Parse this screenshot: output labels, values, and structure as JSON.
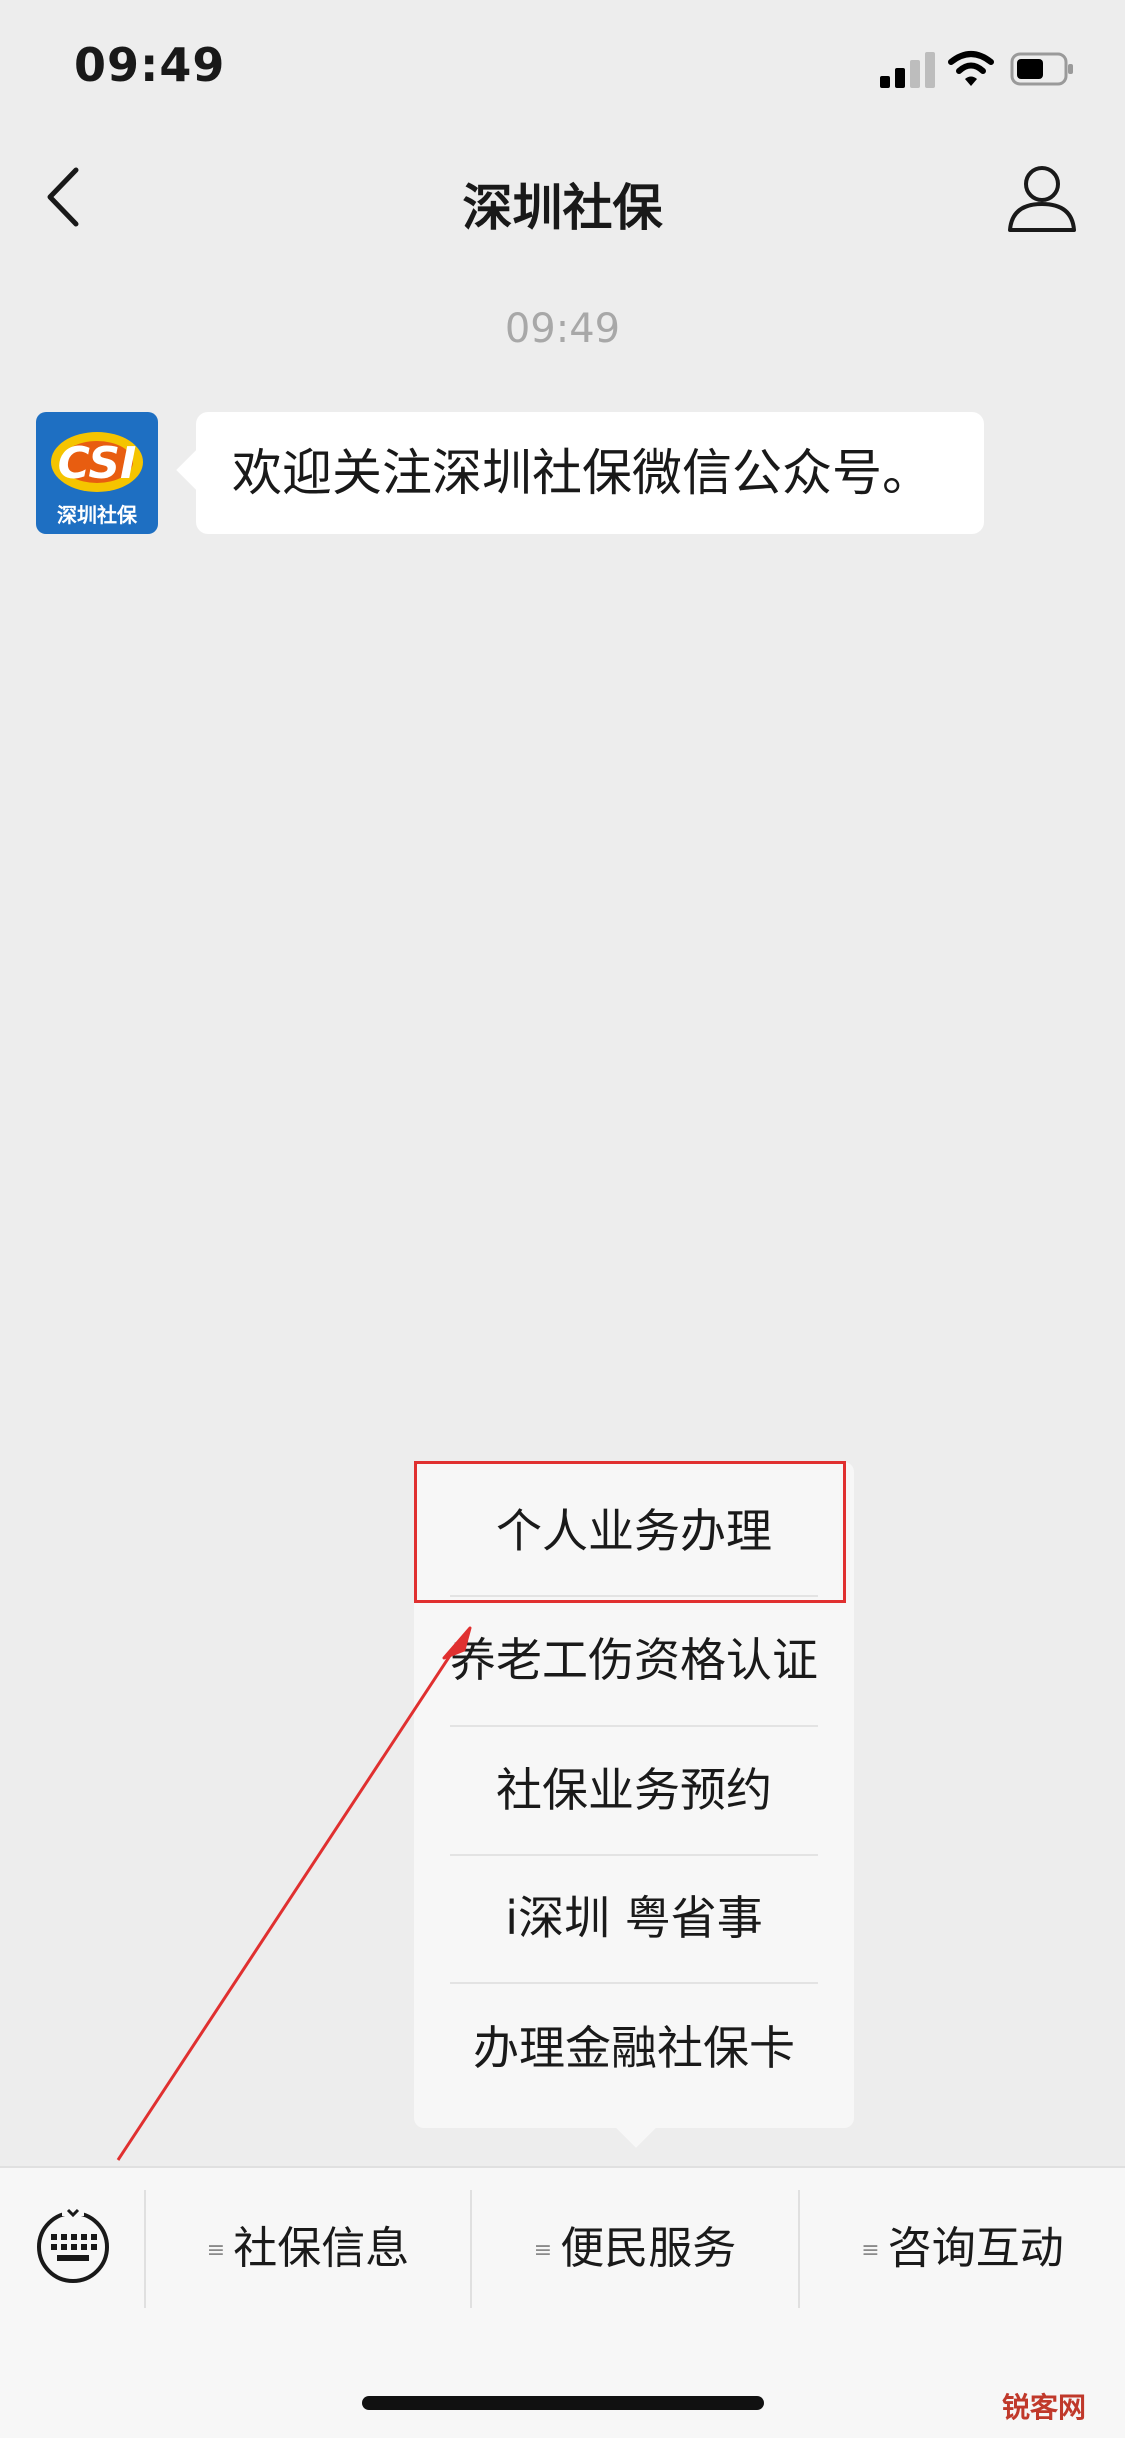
{
  "status_bar": {
    "time": "09:49"
  },
  "nav": {
    "title": "深圳社保"
  },
  "chat": {
    "timestamp": "09:49",
    "avatar_logo_text": "CSI",
    "avatar_caption": "深圳社保",
    "message": "欢迎关注深圳社保微信公众号。"
  },
  "popup_menu": {
    "items": [
      {
        "label": "个人业务办理"
      },
      {
        "label": "养老工伤资格认证"
      },
      {
        "label": "社保业务预约"
      },
      {
        "label": "i深圳 粤省事"
      },
      {
        "label": "办理金融社保卡"
      }
    ],
    "highlighted_index": 0
  },
  "bottom_bar": {
    "tab_icon_glyph": "≡",
    "tabs": [
      {
        "label": "社保信息"
      },
      {
        "label": "便民服务"
      },
      {
        "label": "咨询互动"
      }
    ]
  },
  "watermark": "锐客网",
  "colors": {
    "annotation": "#e03030",
    "background": "#ededed",
    "avatar_bg": "#1e6fc2",
    "logo_yellow": "#f5c400"
  },
  "icons": [
    "back-chevron-icon",
    "profile-icon",
    "keyboard-icon",
    "signal-icon",
    "wifi-icon",
    "battery-icon",
    "menu-lines-icon"
  ]
}
